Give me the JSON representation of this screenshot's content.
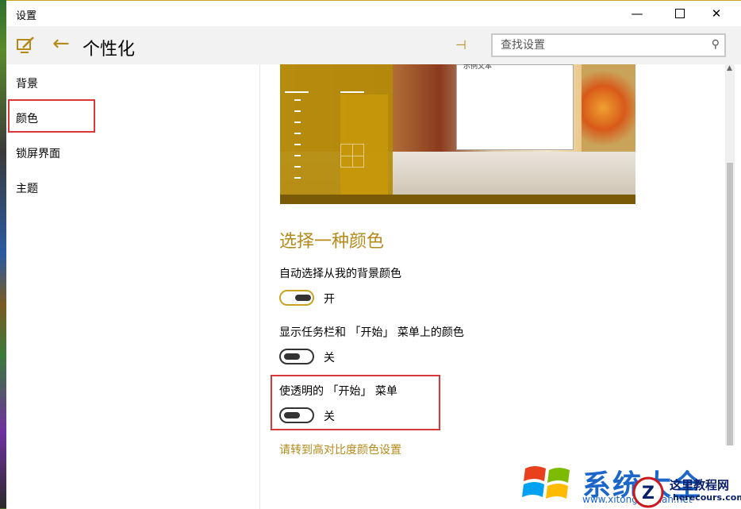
{
  "window": {
    "title": "设置",
    "minimize_glyph": "—",
    "close_glyph": "✕"
  },
  "header": {
    "back_glyph": "←",
    "page_title": "个性化",
    "pin_glyph": "⊣",
    "search_placeholder": "查找设置",
    "search_glyph": "⚲"
  },
  "sidebar": {
    "items": [
      {
        "label": "背景"
      },
      {
        "label": "颜色"
      },
      {
        "label": "锁屏界面"
      },
      {
        "label": "主题"
      }
    ],
    "selected": "颜色"
  },
  "preview": {
    "sample_text": "示例文本"
  },
  "main": {
    "section_title": "选择一种颜色",
    "options": [
      {
        "label": "自动选择从我的背景颜色",
        "state": "开",
        "on": true
      },
      {
        "label": "显示任务栏和 「开始」 菜单上的颜色",
        "state": "关",
        "on": false
      },
      {
        "label": "使透明的 「开始」 菜单",
        "state": "关",
        "on": false
      }
    ],
    "link": "请转到高对比度颜色设置"
  },
  "watermark": {
    "brand": "系统大全",
    "sub": "www.xitongdaquan.net",
    "site_name": "这里教程网",
    "site_url": "herecours.com"
  },
  "colors": {
    "accent": "#b48a1a",
    "highlight": "#d9383a"
  }
}
